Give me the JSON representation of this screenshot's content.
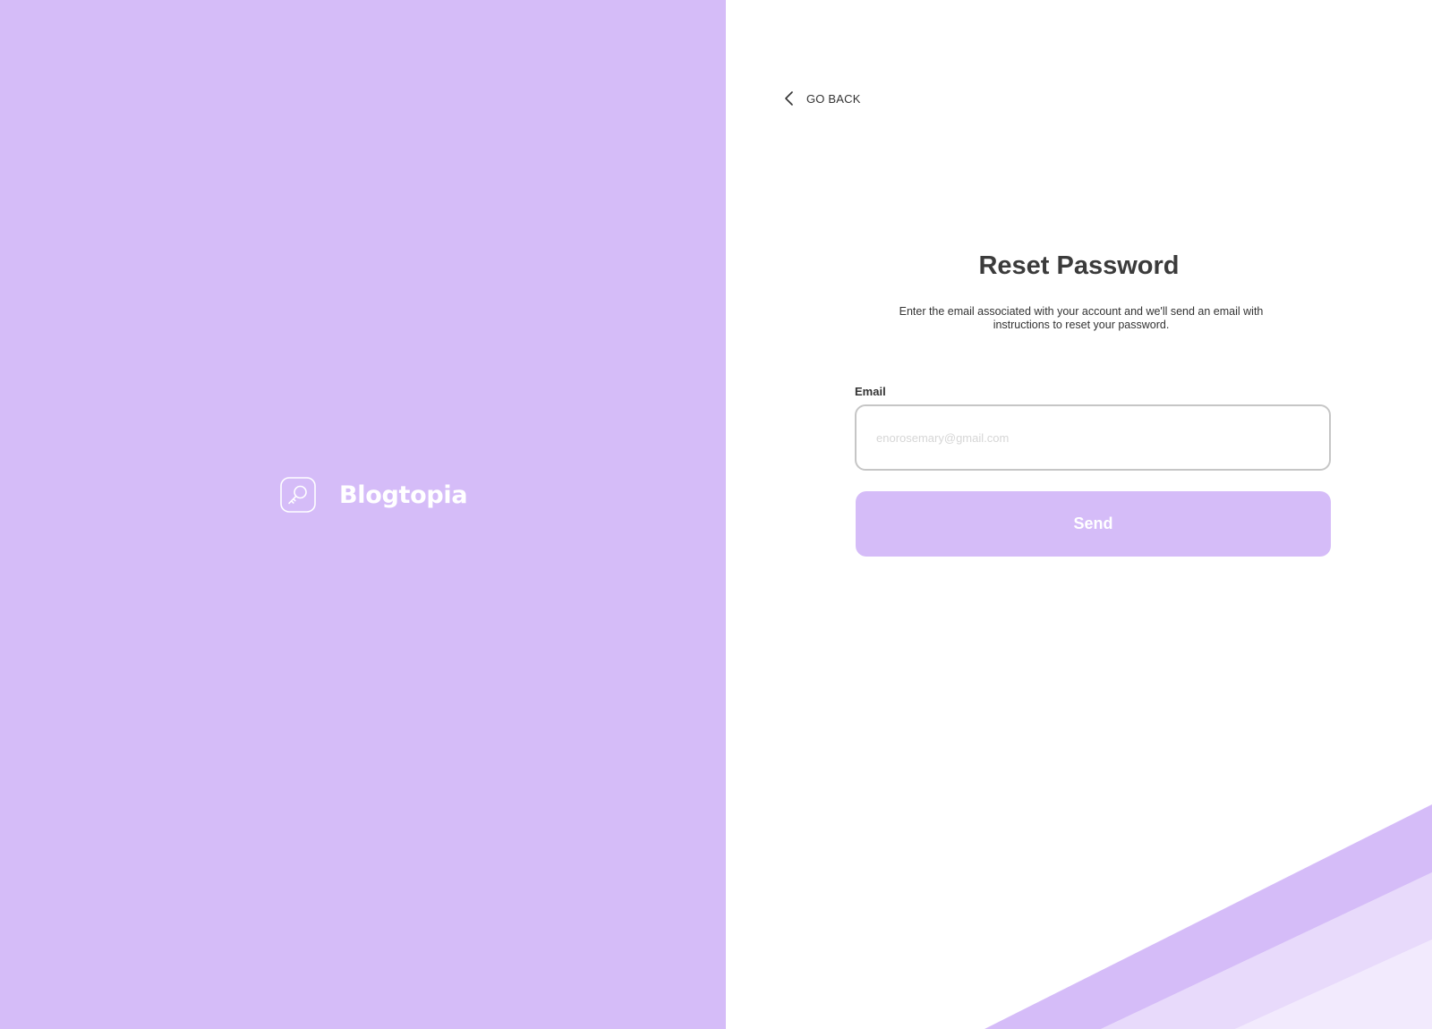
{
  "brand": {
    "name": "Blogtopia",
    "logo_icon": "key-icon"
  },
  "nav": {
    "back_label": "GO BACK",
    "back_icon": "chevron-left-icon"
  },
  "form": {
    "title": "Reset Password",
    "description": "Enter the email associated with your account and we'll send an email with instructions to reset your password.",
    "email_label": "Email",
    "email_placeholder": "enorosemary@gmail.com",
    "email_value": "",
    "send_label": "Send"
  },
  "colors": {
    "accent": "#d5bcf8",
    "accent_light": "#e8dafb",
    "accent_lighter": "#f2eafd",
    "text_dark": "#3b3b3b",
    "background": "#ffffff"
  }
}
